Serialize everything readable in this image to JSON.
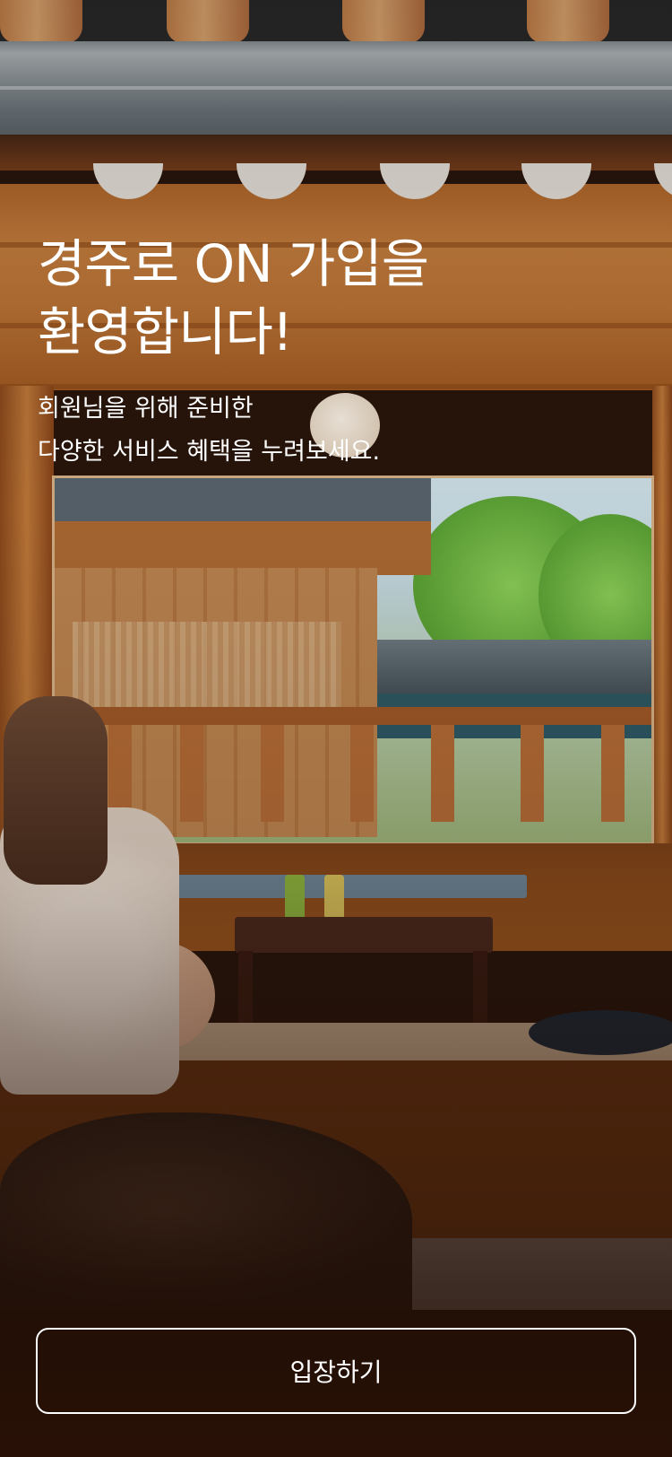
{
  "welcome": {
    "title": "경주로 ON 가입을\n환영합니다!",
    "subtitle": "회원님을 위해 준비한\n다양한 서비스 혜택을 누려보세요."
  },
  "actions": {
    "enter_label": "입장하기"
  },
  "colors": {
    "text": "#ffffff",
    "button_border": "#ffffff"
  }
}
